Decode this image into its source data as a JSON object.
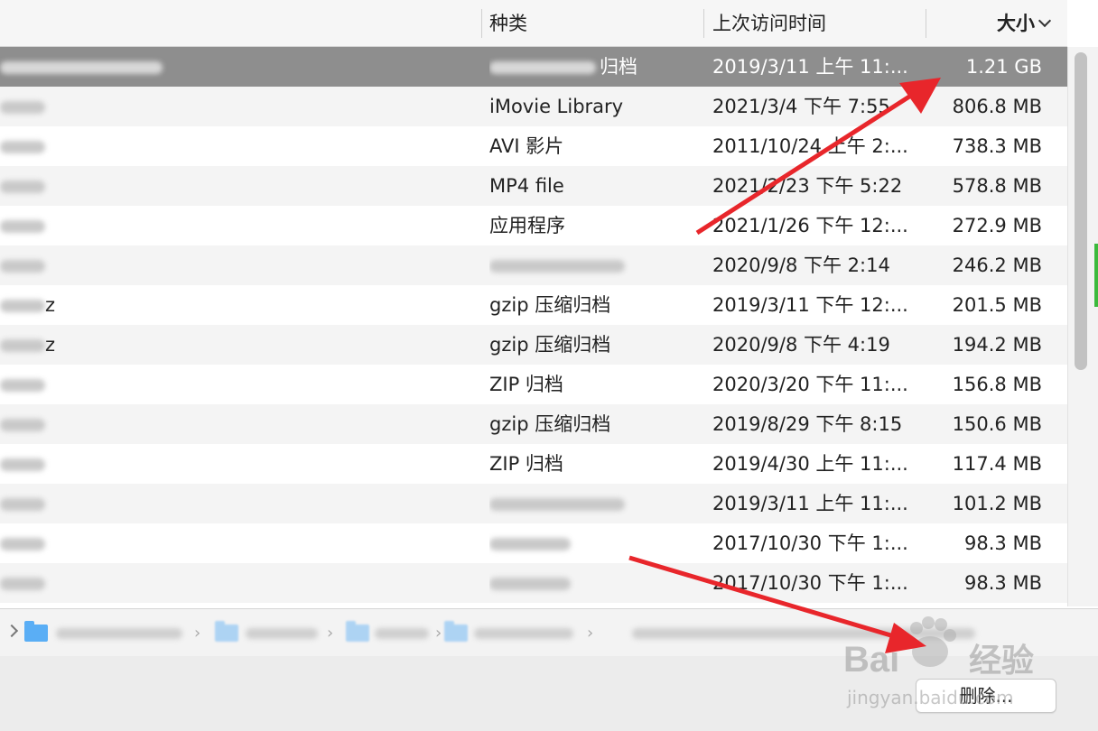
{
  "header": {
    "kind_label": "种类",
    "date_label": "上次访问时间",
    "size_label": "大小"
  },
  "rows": [
    {
      "kind": "归档",
      "date": "2019/3/11 上午 11:...",
      "size": "1.21 GB",
      "selected": true
    },
    {
      "kind": "iMovie Library",
      "date": "2021/3/4 下午 7:55",
      "size": "806.8 MB"
    },
    {
      "kind": "AVI 影片",
      "date": "2011/10/24 上午 2:...",
      "size": "738.3 MB"
    },
    {
      "kind": "MP4 file",
      "date": "2021/2/23 下午 5:22",
      "size": "578.8 MB"
    },
    {
      "kind": "应用程序",
      "date": "2021/1/26 下午 12:...",
      "size": "272.9 MB"
    },
    {
      "kind": "",
      "date": "2020/9/8 下午 2:14",
      "size": "246.2 MB"
    },
    {
      "kind": "gzip 压缩归档",
      "date": "2019/3/11 下午 12:...",
      "size": "201.5 MB",
      "name_suffix": "z"
    },
    {
      "kind": "gzip 压缩归档",
      "date": "2020/9/8 下午 4:19",
      "size": "194.2 MB",
      "name_suffix": "z"
    },
    {
      "kind": "ZIP 归档",
      "date": "2020/3/20 下午 11:...",
      "size": "156.8 MB"
    },
    {
      "kind": "gzip 压缩归档",
      "date": "2019/8/29 下午 8:15",
      "size": "150.6 MB"
    },
    {
      "kind": "ZIP 归档",
      "date": "2019/4/30 上午 11:...",
      "size": "117.4 MB"
    },
    {
      "kind": "",
      "date": "2019/3/11 上午 11:...",
      "size": "101.2 MB"
    },
    {
      "kind": "",
      "date": "2017/10/30 下午 1:...",
      "size": "98.3 MB"
    },
    {
      "kind": "",
      "date": "2017/10/30 下午 1:...",
      "size": "98.3 MB"
    }
  ],
  "footer": {
    "delete_label": "删除..."
  },
  "watermark": {
    "brand_left": "Bai",
    "brand_right": "经验",
    "url": "jingyan.baidu.com"
  },
  "colors": {
    "selected_row": "#8e8e8e",
    "folder": "#5aaef5",
    "annotation_arrow": "#e8262b"
  }
}
